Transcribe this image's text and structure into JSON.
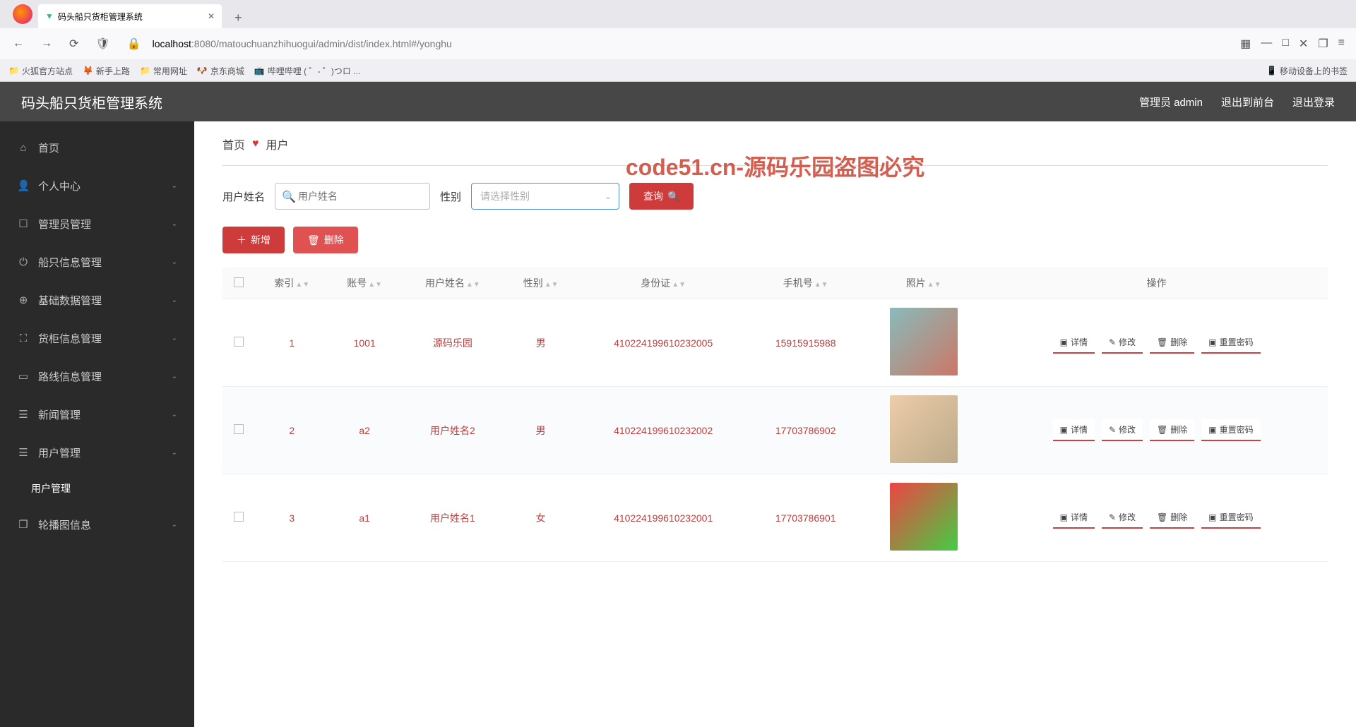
{
  "browser": {
    "tab_title": "码头船只货柜管理系统",
    "url_host": "localhost",
    "url_path": ":8080/matouchuanzhihuogui/admin/dist/index.html#/yonghu",
    "bookmarks": [
      "火狐官方站点",
      "新手上路",
      "常用网址",
      "京东商城",
      "哔哩哔哩 ( ゜- ゜)つロ ..."
    ],
    "bookmark_right": "移动设备上的书签"
  },
  "app": {
    "title": "码头船只货柜管理系统",
    "top_right": {
      "admin": "管理员 admin",
      "toFront": "退出到前台",
      "logout": "退出登录"
    }
  },
  "sidebar": {
    "items": [
      {
        "icon": "⌂",
        "label": "首页",
        "expandable": false
      },
      {
        "icon": "👤",
        "label": "个人中心",
        "expandable": true
      },
      {
        "icon": "☐",
        "label": "管理员管理",
        "expandable": true
      },
      {
        "icon": "⏻",
        "label": "船只信息管理",
        "expandable": true
      },
      {
        "icon": "⊕",
        "label": "基础数据管理",
        "expandable": true
      },
      {
        "icon": "⛶",
        "label": "货柜信息管理",
        "expandable": true
      },
      {
        "icon": "▭",
        "label": "路线信息管理",
        "expandable": true
      },
      {
        "icon": "☰",
        "label": "新闻管理",
        "expandable": true
      },
      {
        "icon": "☰",
        "label": "用户管理",
        "expandable": true,
        "submenu": [
          "用户管理"
        ]
      },
      {
        "icon": "❐",
        "label": "轮播图信息",
        "expandable": true
      }
    ]
  },
  "breadcrumb": {
    "home": "首页",
    "current": "用户"
  },
  "filters": {
    "name_label": "用户姓名",
    "name_placeholder": "用户姓名",
    "gender_label": "性别",
    "gender_placeholder": "请选择性别",
    "search_label": "查询"
  },
  "action_buttons": {
    "add": "新增",
    "delete": "删除"
  },
  "table": {
    "headers": [
      "",
      "索引",
      "账号",
      "用户姓名",
      "性别",
      "身份证",
      "手机号",
      "照片",
      "操作"
    ],
    "operations": {
      "detail": "详情",
      "edit": "修改",
      "del": "删除",
      "reset": "重置密码"
    },
    "rows": [
      {
        "index": "1",
        "account": "1001",
        "name": "源码乐园",
        "gender": "男",
        "idcard": "410224199610232005",
        "phone": "15915915988",
        "photo": "p1"
      },
      {
        "index": "2",
        "account": "a2",
        "name": "用户姓名2",
        "gender": "男",
        "idcard": "410224199610232002",
        "phone": "17703786902",
        "photo": "p2"
      },
      {
        "index": "3",
        "account": "a1",
        "name": "用户姓名1",
        "gender": "女",
        "idcard": "410224199610232001",
        "phone": "17703786901",
        "photo": "p3"
      }
    ]
  },
  "watermark_text": "code51.cn-源码乐园盗图必究"
}
